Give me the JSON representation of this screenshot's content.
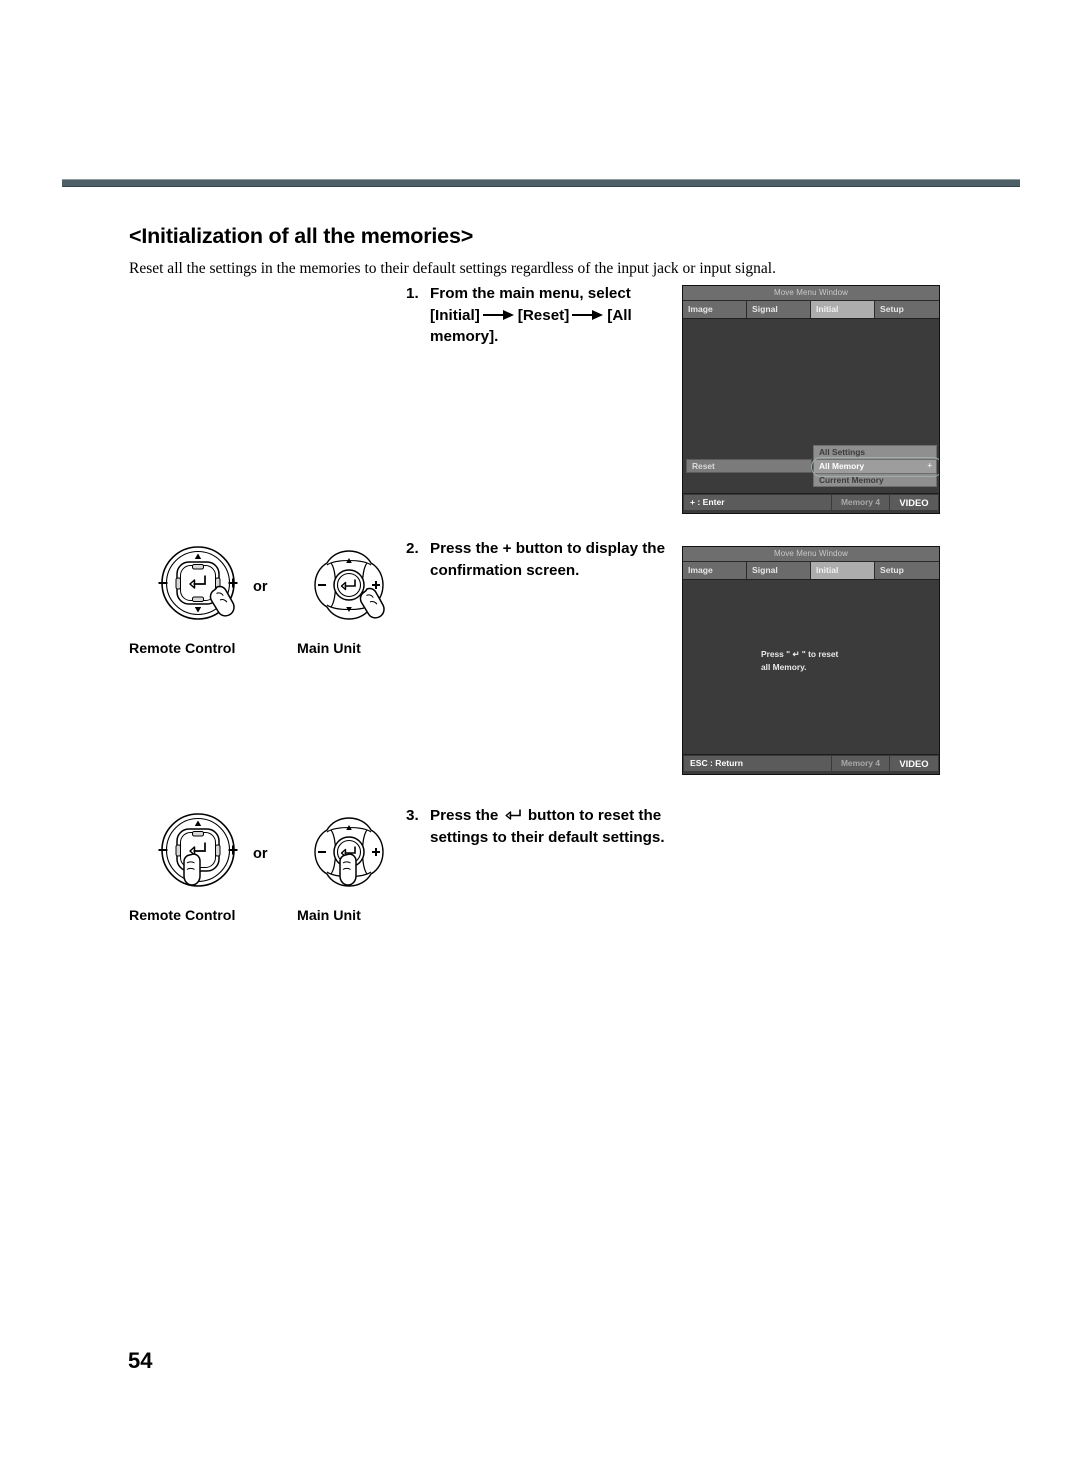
{
  "page": {
    "number": "54",
    "section_title": "<Initialization of all the memories>",
    "lede": "Reset all the settings in the memories to their default settings regardless of the input jack or input signal."
  },
  "steps": [
    {
      "number": "1.",
      "line1": "From the main menu, select",
      "bracket1": "[Initial]",
      "bracket2": "[Reset]",
      "bracket3": "[All",
      "line3": "memory]."
    },
    {
      "number": "2.",
      "line1": "Press the + button to display the",
      "line2": "confirmation screen."
    },
    {
      "number": "3.",
      "pre": "Press the",
      "post": "button to reset the",
      "line2": "settings to their default settings."
    }
  ],
  "controls": {
    "or_label": "or",
    "remote_caption": "Remote Control",
    "unit_caption": "Main Unit"
  },
  "osd_screens": [
    {
      "titlebar": "Move Menu Window",
      "tabs": [
        {
          "label": "Image",
          "selected": false
        },
        {
          "label": "Signal",
          "selected": false
        },
        {
          "label": "Initial",
          "selected": true
        },
        {
          "label": "Setup",
          "selected": false
        }
      ],
      "left_item": "Reset",
      "submenu": [
        {
          "label": "All Settings",
          "selected": false,
          "indicator": ""
        },
        {
          "label": "All Memory",
          "selected": true,
          "indicator": "+"
        },
        {
          "label": "Current Memory",
          "selected": false,
          "indicator": ""
        }
      ],
      "status": {
        "main": "+ : Enter",
        "memory": "Memory 4",
        "source": "VIDEO"
      }
    },
    {
      "titlebar": "Move Menu Window",
      "tabs": [
        {
          "label": "Image",
          "selected": false
        },
        {
          "label": "Signal",
          "selected": false
        },
        {
          "label": "Initial",
          "selected": true
        },
        {
          "label": "Setup",
          "selected": false
        }
      ],
      "message": "Press \" ↵ \" to reset\nall Memory.",
      "status": {
        "main": "ESC : Return",
        "memory": "Memory 4",
        "source": "VIDEO"
      }
    }
  ],
  "colors": {
    "header_rule": "#4e6066",
    "osd_background": "#3b3b3b",
    "osd_tab": "#6b6b6b",
    "osd_tab_selected": "#adadad",
    "selection_ring": "#9fb0ad"
  }
}
